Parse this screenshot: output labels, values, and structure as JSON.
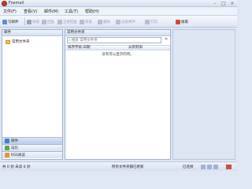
{
  "window": {
    "title": "Foxmail"
  },
  "menu": [
    "文件(F)",
    "查看(V)",
    "邮件(M)",
    "工具(T)",
    "帮助(H)"
  ],
  "toolbar": {
    "new_mail": "写邮件",
    "receive": "收取",
    "reply": "回复",
    "reply_all": "全部回复",
    "forward": "转发",
    "delete": "删除",
    "junk": "垃圾邮件",
    "print": "打印",
    "send_receive": "收取"
  },
  "left": {
    "header": "邮件",
    "tree": [
      {
        "label": "常用文件夹"
      }
    ],
    "nav": [
      {
        "label": "邮件",
        "color": "#3f7fd4"
      },
      {
        "label": "日历",
        "color": "#5aa84a"
      },
      {
        "label": "RSS阅读",
        "color": "#e8923a"
      }
    ]
  },
  "middle": {
    "header": "常用文件夹",
    "search_placeholder": "搜索 常用文件夹",
    "columns": [
      "排序字段:日期",
      "从新到旧"
    ],
    "empty_message": "没有可以显示的项。"
  },
  "status": {
    "counts": "共 0 封 未读 0 封",
    "sync": "所有文件夹都已更新",
    "online": "已连接"
  },
  "colors": {
    "accent": "#3f7fd4",
    "logo": "#c43a2a"
  }
}
